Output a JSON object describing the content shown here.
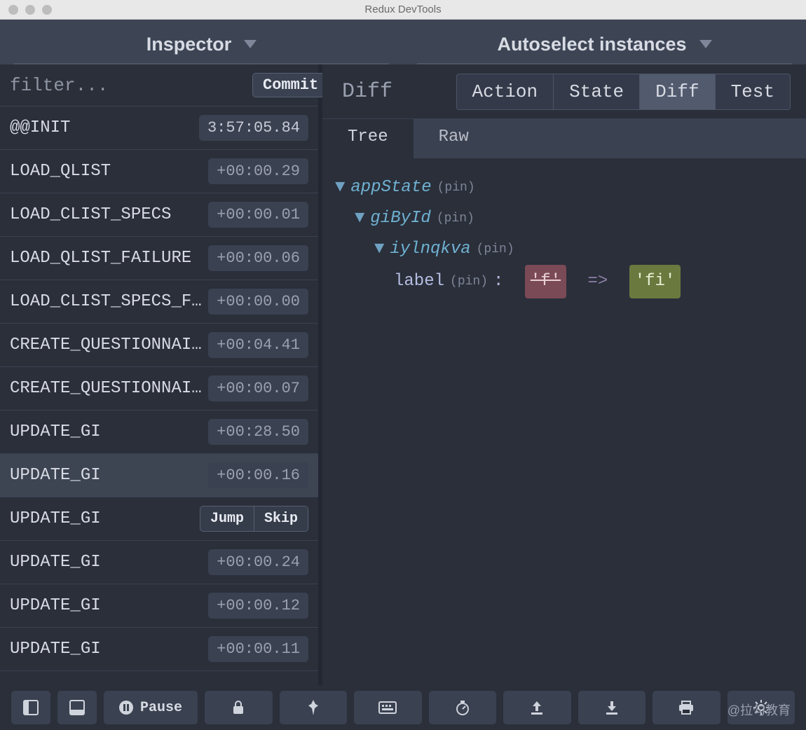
{
  "window": {
    "title": "Redux DevTools"
  },
  "top": {
    "inspector_label": "Inspector",
    "instances_label": "Autoselect instances"
  },
  "filter": {
    "placeholder": "filter...",
    "commit_label": "Commit"
  },
  "actions": [
    {
      "name": "@@INIT",
      "time": "3:57:05.84",
      "first": true
    },
    {
      "name": "LOAD_QLIST",
      "time": "+00:00.29"
    },
    {
      "name": "LOAD_CLIST_SPECS",
      "time": "+00:00.01"
    },
    {
      "name": "LOAD_QLIST_FAILURE",
      "time": "+00:00.06"
    },
    {
      "name": "LOAD_CLIST_SPECS_FA…",
      "time": "+00:00.00"
    },
    {
      "name": "CREATE_QUESTIONNAIRE",
      "time": "+00:04.41"
    },
    {
      "name": "CREATE_QUESTIONNAIR…",
      "time": "+00:00.07"
    },
    {
      "name": "UPDATE_GI",
      "time": "+00:28.50"
    },
    {
      "name": "UPDATE_GI",
      "time": "+00:00.16",
      "selected": true
    },
    {
      "name": "UPDATE_GI",
      "hovered": true,
      "jump": "Jump",
      "skip": "Skip"
    },
    {
      "name": "UPDATE_GI",
      "time": "+00:00.24"
    },
    {
      "name": "UPDATE_GI",
      "time": "+00:00.12"
    },
    {
      "name": "UPDATE_GI",
      "time": "+00:00.11"
    }
  ],
  "right": {
    "heading": "Diff",
    "tabs": {
      "action": "Action",
      "state": "State",
      "diff": "Diff",
      "test": "Test"
    },
    "subtabs": {
      "tree": "Tree",
      "raw": "Raw"
    }
  },
  "diff": {
    "root": "appState",
    "l2": "giById",
    "l3": "iylnqkva",
    "leaf": "label",
    "pin": "(pin)",
    "old": "'f'",
    "arrow": "=>",
    "new": "'fi'"
  },
  "bottom": {
    "pause": "Pause"
  },
  "watermark": "@拉勾教育"
}
